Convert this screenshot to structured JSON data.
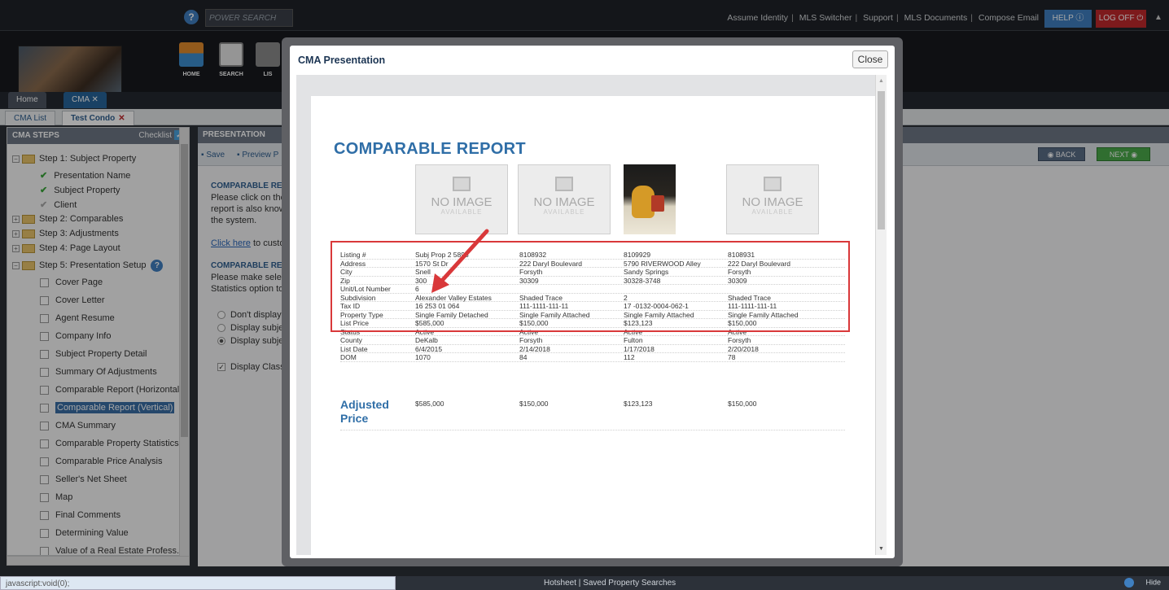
{
  "header": {
    "power_search_placeholder": "POWER SEARCH",
    "links": [
      "Assume Identity",
      "MLS Switcher",
      "Support",
      "MLS Documents",
      "Compose Email"
    ],
    "help_label": "HELP ⓘ",
    "logoff_label": "LOG OFF ⏻"
  },
  "nav": {
    "home_label": "HOME",
    "search_label": "SEARCH",
    "list_label": "LIS"
  },
  "top_tabs": [
    {
      "label": "Home"
    },
    {
      "label": "CMA ✕"
    }
  ],
  "sub_tabs": [
    {
      "label": "CMA List"
    },
    {
      "label": "Test Condo",
      "close": "✕"
    }
  ],
  "steps_panel": {
    "title": "CMA STEPS",
    "checklist_label": "Checklist",
    "items": [
      {
        "label": "Step 1: Subject Property"
      },
      {
        "label": "Presentation Name"
      },
      {
        "label": "Subject Property"
      },
      {
        "label": "Client"
      },
      {
        "label": "Step 2: Comparables"
      },
      {
        "label": "Step 3: Adjustments"
      },
      {
        "label": "Step 4: Page Layout"
      },
      {
        "label": "Step 5: Presentation Setup"
      },
      {
        "label": "Cover Page"
      },
      {
        "label": "Cover Letter"
      },
      {
        "label": "Agent Resume"
      },
      {
        "label": "Company Info"
      },
      {
        "label": "Subject Property Detail"
      },
      {
        "label": "Summary Of Adjustments"
      },
      {
        "label": "Comparable Report (Horizontal)"
      },
      {
        "label": "Comparable Report (Vertical)"
      },
      {
        "label": "CMA Summary"
      },
      {
        "label": "Comparable Property Statistics"
      },
      {
        "label": "Comparable Price Analysis"
      },
      {
        "label": "Seller's Net Sheet"
      },
      {
        "label": "Map"
      },
      {
        "label": "Final Comments"
      },
      {
        "label": "Determining Value"
      },
      {
        "label": "Value of a Real Estate Profess."
      }
    ]
  },
  "main": {
    "section_title": "PRESENTATION",
    "save_label": "Save",
    "preview_label": "Preview P",
    "back_label": "◉ BACK",
    "next_label": "NEXT ◉",
    "heading1": "COMPARABLE REP",
    "para1_line1": "Please click on the",
    "para1_line2": "report is also know",
    "para1_line3": "the system.",
    "click_here": "Click here",
    "click_here_suffix": " to custo",
    "heading2": "COMPARABLE REP",
    "para2_line1": "Please make select",
    "para2_line2": "Statistics option to",
    "radio1": "Don't display th",
    "radio2": "Display subject",
    "radio3": "Display subject",
    "checkbox1": "Display Class S"
  },
  "modal": {
    "title": "CMA Presentation",
    "close_label": "Close",
    "report_title": "COMPARABLE REPORT",
    "no_image_main": "NO IMAGE",
    "no_image_sub": "AVAILABLE",
    "rows": [
      {
        "label": "Listing #",
        "v1": "Subj Prop 2 5893",
        "v2": "8108932",
        "v3": "8109929",
        "v4": "8108931"
      },
      {
        "label": "Address",
        "v1": "1570 St   Dr",
        "v2": "222 Daryl Boulevard",
        "v3": "5790 RIVERWOOD Alley",
        "v4": "222 Daryl Boulevard"
      },
      {
        "label": "City",
        "v1": "Snell",
        "v2": "Forsyth",
        "v3": "Sandy Springs",
        "v4": "Forsyth"
      },
      {
        "label": "Zip",
        "v1": "300",
        "v2": "30309",
        "v3": "30328-3748",
        "v4": "30309"
      },
      {
        "label": "Unit/Lot Number",
        "v1": "6",
        "v2": "",
        "v3": "",
        "v4": ""
      },
      {
        "label": "Subdivision",
        "v1": "Alexander Valley Estates",
        "v2": "Shaded Trace",
        "v3": "2",
        "v4": "Shaded Trace"
      },
      {
        "label": "Tax ID",
        "v1": "16 253 01 064",
        "v2": "111-1111-111-11",
        "v3": "17 -0132-0004-062-1",
        "v4": "111-1111-111-11"
      },
      {
        "label": "Property Type",
        "v1": "Single Family Detached",
        "v2": "Single Family Attached",
        "v3": "Single Family Attached",
        "v4": "Single Family Attached"
      },
      {
        "label": "List Price",
        "v1": "$585,000",
        "v2": "$150,000",
        "v3": "$123,123",
        "v4": "$150,000"
      },
      {
        "label": "Status",
        "v1": "Active",
        "v2": "Active",
        "v3": "Active",
        "v4": "Active"
      },
      {
        "label": "County",
        "v1": "DeKalb",
        "v2": "Forsyth",
        "v3": "Fulton",
        "v4": "Forsyth"
      },
      {
        "label": "List Date",
        "v1": "6/4/2015",
        "v2": "2/14/2018",
        "v3": "1/17/2018",
        "v4": "2/20/2018"
      },
      {
        "label": "DOM",
        "v1": "1070",
        "v2": "84",
        "v3": "112",
        "v4": "78"
      }
    ],
    "adjusted_label": "Adjusted Price",
    "adjusted": {
      "v1": "$585,000",
      "v2": "$150,000",
      "v3": "$123,123",
      "v4": "$150,000"
    }
  },
  "status": {
    "url": "javascript:void(0);",
    "links": "Hotsheet  |  Saved Property Searches",
    "hide_label": "Hide"
  },
  "colors": {
    "accent": "#2f6ea7",
    "highlight_box": "#d9383a",
    "logoff": "#c0282b",
    "help": "#3f7fc0"
  }
}
